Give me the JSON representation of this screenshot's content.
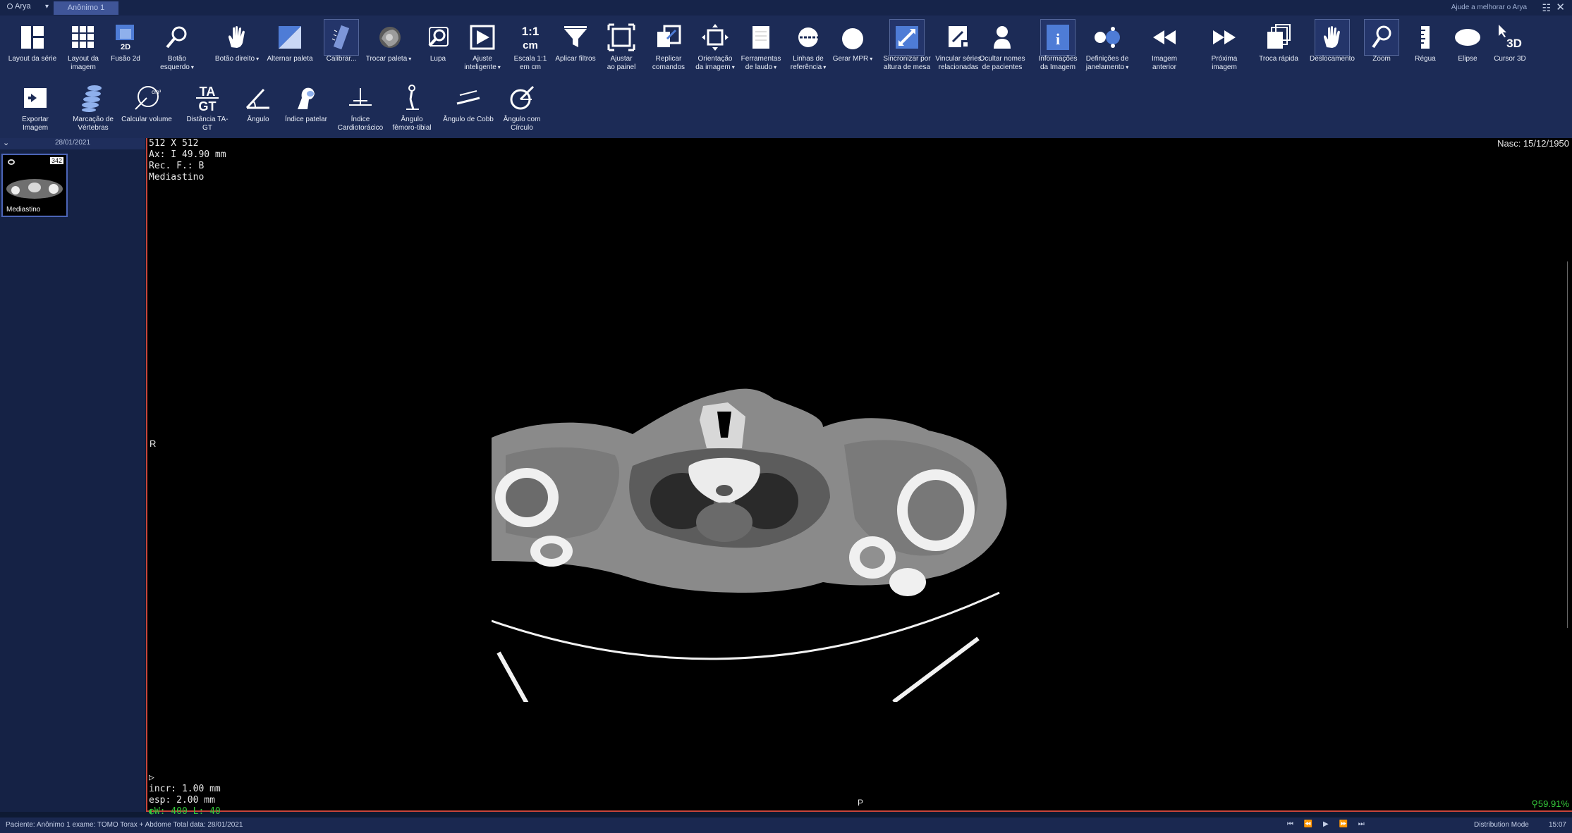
{
  "titlebar": {
    "app": "Arya",
    "tab": "Anônimo 1",
    "help": "Ajude a melhorar o Arya",
    "grid_icon": "☷",
    "close_icon": "✕"
  },
  "toolbar_row1": [
    {
      "id": "layout-serie",
      "label": "Layout da série",
      "icon": "layout-series-icon"
    },
    {
      "id": "layout-imagem",
      "label": "Layout da\nimagem",
      "icon": "grid-icon"
    },
    {
      "id": "fusao-2d",
      "label": "Fusão 2d",
      "icon": "fusion-2d-icon"
    },
    {
      "id": "botao-esquerdo",
      "label": "Botão esquerdo",
      "icon": "magnifier-icon",
      "dropdown": true
    },
    {
      "id": "botao-direito",
      "label": "Botão direito",
      "icon": "hand-icon",
      "dropdown": true
    },
    {
      "id": "alternar-paleta",
      "label": "Alternar paleta",
      "icon": "palette-icon"
    },
    {
      "id": "calibrar",
      "label": "Calibrar...",
      "icon": "calibrate-ruler-icon",
      "active": true
    },
    {
      "id": "trocar-paleta",
      "label": "Trocar paleta",
      "icon": "head-icon",
      "dropdown": true
    },
    {
      "id": "lupa",
      "label": "Lupa",
      "icon": "loupe-icon"
    },
    {
      "id": "ajuste-inteligente",
      "label": "Ajuste\ninteligente",
      "icon": "smart-fit-icon",
      "dropdown": true
    },
    {
      "id": "escala",
      "label": "Escala 1:1\nem cm",
      "icon": "scale-icon"
    },
    {
      "id": "aplicar-filtros",
      "label": "Aplicar filtros",
      "icon": "filter-icon"
    },
    {
      "id": "ajustar-painel",
      "label": "Ajustar\nao painel",
      "icon": "fit-panel-icon"
    },
    {
      "id": "replicar-comandos",
      "label": "Replicar\ncomandos",
      "icon": "replicate-icon"
    },
    {
      "id": "orientacao",
      "label": "Orientação\nda imagem",
      "icon": "orientation-icon",
      "dropdown": true
    },
    {
      "id": "ferramentas-laudo",
      "label": "Ferramentas\nde laudo",
      "icon": "report-icon",
      "dropdown": true
    },
    {
      "id": "linhas-referencia",
      "label": "Linhas de\nreferência",
      "icon": "reference-lines-icon",
      "dropdown": true
    },
    {
      "id": "gerar-mpr",
      "label": "Gerar MPR",
      "icon": "sphere-icon",
      "dropdown": true
    },
    {
      "id": "sincronizar",
      "label": "Sincronizar por\naltura de mesa",
      "icon": "sync-icon",
      "active": true
    },
    {
      "id": "vincular-series",
      "label": "Vincular séries\nrelacionadas",
      "icon": "link-series-icon"
    },
    {
      "id": "ocultar-nomes",
      "label": "Ocultar nomes\nde pacientes",
      "icon": "hide-patient-icon"
    },
    {
      "id": "info-imagem",
      "label": "Informações\nda Imagem",
      "icon": "info-icon",
      "active": true
    },
    {
      "id": "definicoes-janelamento",
      "label": "Definições de\njanelamento",
      "icon": "window-level-icon",
      "dropdown": true
    },
    {
      "id": "imagem-anterior",
      "label": "Imagem anterior",
      "icon": "rewind-icon"
    },
    {
      "id": "proxima-imagem",
      "label": "Próxima imagem",
      "icon": "forward-icon"
    },
    {
      "id": "troca-rapida",
      "label": "Troca rápida",
      "icon": "quick-swap-icon"
    },
    {
      "id": "deslocamento",
      "label": "Deslocamento",
      "icon": "pan-hand-icon",
      "active": true
    },
    {
      "id": "zoom",
      "label": "Zoom",
      "icon": "zoom-icon",
      "active": true
    },
    {
      "id": "regua",
      "label": "Régua",
      "icon": "ruler-icon"
    },
    {
      "id": "elipse",
      "label": "Elipse",
      "icon": "ellipse-icon"
    },
    {
      "id": "cursor-3d",
      "label": "Cursor 3D",
      "icon": "cursor-3d-icon"
    }
  ],
  "toolbar_row2": [
    {
      "id": "exportar-imagem",
      "label": "Exportar Imagem",
      "icon": "export-icon"
    },
    {
      "id": "marcacao-vertebras",
      "label": "Marcação de\nVértebras",
      "icon": "spine-icon"
    },
    {
      "id": "calcular-volume",
      "label": "Calcular volume",
      "icon": "volume-icon"
    },
    {
      "id": "distancia-tagt",
      "label": "Distância TA-GT",
      "icon": "ta-gt-icon"
    },
    {
      "id": "angulo",
      "label": "Ângulo",
      "icon": "angle-icon"
    },
    {
      "id": "indice-patelar",
      "label": "Índice patelar",
      "icon": "patella-icon"
    },
    {
      "id": "indice-cardiotoracico",
      "label": "Índice\nCardiotorácico",
      "icon": "cardiothoracic-icon"
    },
    {
      "id": "angulo-femoro-tibial",
      "label": "Ângulo\nfêmoro-tibial",
      "icon": "femoro-tibial-icon"
    },
    {
      "id": "angulo-cobb",
      "label": "Ângulo de Cobb",
      "icon": "cobb-icon"
    },
    {
      "id": "angulo-circulo",
      "label": "Ângulo com\nCírculo",
      "icon": "angle-circle-icon"
    }
  ],
  "icon_text": {
    "scale_top": "1:1",
    "scale_bottom": "cm",
    "tagt_top": "TA",
    "tagt_bottom": "GT",
    "cursor3d": "3D",
    "fusion": "2D",
    "volume": "cm³"
  },
  "left_panel": {
    "date": "28/01/2021",
    "thumb_label": "Mediastino",
    "thumb_count": "342"
  },
  "viewer": {
    "matrix": "512 X 512",
    "axial": "Ax: I  49.90 mm",
    "rec": "Rec. F.: B",
    "window_name": "Mediastino",
    "birth": "Nasc: 15/12/1950",
    "side_left": "R",
    "side_bottom": "P",
    "incr": "incr: 1.00 mm",
    "esp": "esp: 2.00 mm",
    "wl": "W: 400 L: 40",
    "zoom": "59.91%"
  },
  "statusbar": {
    "text": "Paciente: Anônimo 1 exame: TOMO Torax + Abdome Total data: 28/01/2021",
    "media": "⏮ ⏪ ▶ ⏩ ⏭",
    "mode": "Distribution Mode",
    "clock": "15:07"
  },
  "colors": {
    "accent": "#4c65b7",
    "border_red": "#c8453b",
    "overlay_green": "#34c83a",
    "toolbar": "#1c2b56"
  }
}
